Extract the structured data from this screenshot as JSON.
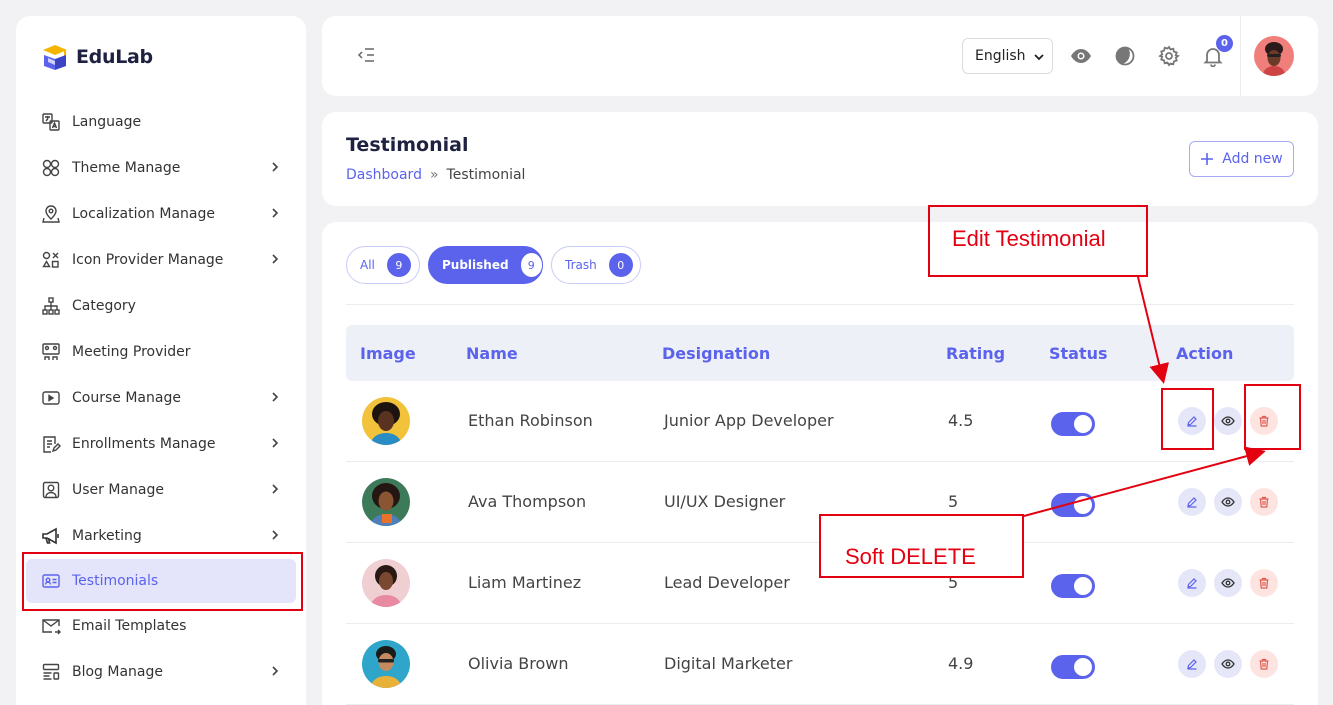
{
  "app": {
    "name": "EduLab"
  },
  "sidebar": {
    "items": [
      {
        "label": "Language",
        "icon": "translate-icon",
        "has_chevron": false
      },
      {
        "label": "Theme Manage",
        "icon": "theme-icon",
        "has_chevron": true
      },
      {
        "label": "Localization Manage",
        "icon": "map-pin-icon",
        "has_chevron": true
      },
      {
        "label": "Icon Provider Manage",
        "icon": "shapes-icon",
        "has_chevron": true
      },
      {
        "label": "Category",
        "icon": "hierarchy-icon",
        "has_chevron": false
      },
      {
        "label": "Meeting Provider",
        "icon": "meeting-icon",
        "has_chevron": false
      },
      {
        "label": "Course Manage",
        "icon": "play-icon",
        "has_chevron": true
      },
      {
        "label": "Enrollments Manage",
        "icon": "edit-doc-icon",
        "has_chevron": true
      },
      {
        "label": "User Manage",
        "icon": "user-icon",
        "has_chevron": true
      },
      {
        "label": "Marketing",
        "icon": "megaphone-icon",
        "has_chevron": true
      },
      {
        "label": "Testimonials",
        "icon": "testimonial-icon",
        "has_chevron": false,
        "active": true
      },
      {
        "label": "Email Templates",
        "icon": "mail-icon",
        "has_chevron": false
      },
      {
        "label": "Blog Manage",
        "icon": "blog-icon",
        "has_chevron": true
      }
    ]
  },
  "topbar": {
    "language": "English",
    "notification_count": "0"
  },
  "page": {
    "title": "Testimonial",
    "breadcrumb": {
      "home": "Dashboard",
      "separator": "»",
      "current": "Testimonial"
    },
    "add_label": "Add new"
  },
  "filters": [
    {
      "label": "All",
      "count": "9"
    },
    {
      "label": "Published",
      "count": "9",
      "active": true
    },
    {
      "label": "Trash",
      "count": "0"
    }
  ],
  "table": {
    "headers": [
      "Image",
      "Name",
      "Designation",
      "Rating",
      "Status",
      "Action"
    ],
    "rows": [
      {
        "name": "Ethan Robinson",
        "designation": "Junior App Developer",
        "rating": "4.5",
        "status": true
      },
      {
        "name": "Ava Thompson",
        "designation": "UI/UX Designer",
        "rating": "5",
        "status": true
      },
      {
        "name": "Liam Martinez",
        "designation": "Lead Developer",
        "rating": "5",
        "status": true
      },
      {
        "name": "Olivia Brown",
        "designation": "Digital Marketer",
        "rating": "4.9",
        "status": true
      }
    ]
  },
  "annotations": {
    "edit_label": "Edit Testimonial",
    "delete_label": "Soft DELETE"
  },
  "colors": {
    "accent": "#5b63ec",
    "annotation": "#e30010",
    "delete_bg": "#fde4e1"
  }
}
